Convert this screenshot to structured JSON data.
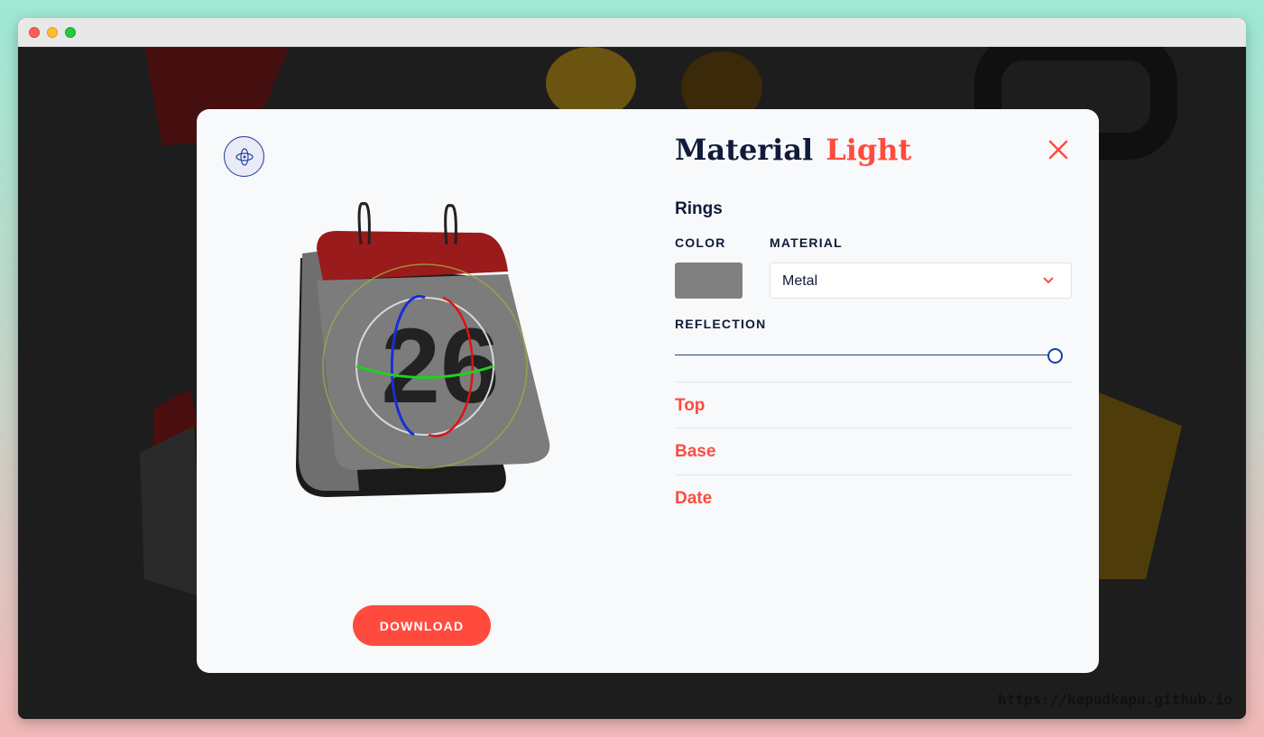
{
  "window": {
    "url_label": "https://kapudkapu.github.io"
  },
  "modal": {
    "title_part1": "Material",
    "title_part2": "Light",
    "section_title": "Rings",
    "color_label": "COLOR",
    "material_label": "MATERIAL",
    "reflection_label": "REFLECTION",
    "ring_color": "#808080",
    "material_value": "Metal",
    "reflection_value": 1.0,
    "accordion": [
      {
        "label": "Top"
      },
      {
        "label": "Base"
      },
      {
        "label": "Date"
      }
    ],
    "calendar_date": "26",
    "download_label": "DOWNLOAD",
    "colors": {
      "accent": "#ff4b3e",
      "navy": "#101a3a",
      "calendar_top": "#9a1b1b",
      "calendar_body": "#7c7c7c"
    },
    "icons": {
      "orbit": "orbit-icon",
      "close": "close-icon",
      "chevron": "chevron-down-icon"
    }
  }
}
